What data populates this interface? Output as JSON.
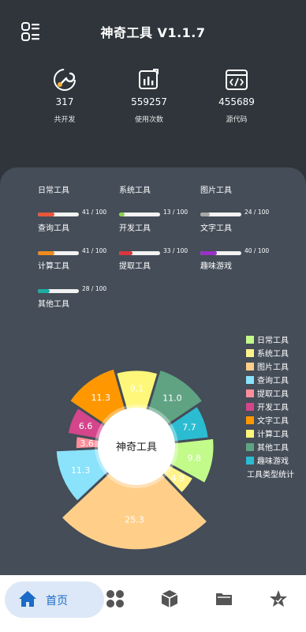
{
  "header": {
    "title": "神奇工具 V1.1.7"
  },
  "stats": [
    {
      "value": "317",
      "label": "共开发",
      "icon": "wrench-icon"
    },
    {
      "value": "559257",
      "label": "使用次数",
      "icon": "bar-chart-icon"
    },
    {
      "value": "455689",
      "label": "源代码",
      "icon": "code-window-icon"
    }
  ],
  "categories": {
    "headers": [
      "日常工具",
      "系统工具",
      "图片工具"
    ],
    "items": [
      {
        "label": "查询工具",
        "count": 41,
        "max": 100,
        "display": "41 / 100",
        "color": "#e8563a"
      },
      {
        "label": "开发工具",
        "count": 13,
        "max": 100,
        "display": "13 / 100",
        "color": "#8ed14b"
      },
      {
        "label": "文字工具",
        "count": 24,
        "max": 100,
        "display": "24 / 100",
        "color": "#a8a8a8"
      },
      {
        "label": "计算工具",
        "count": 41,
        "max": 100,
        "display": "41 / 100",
        "color": "#f08a1e"
      },
      {
        "label": "提取工具",
        "count": 33,
        "max": 100,
        "display": "33 / 100",
        "color": "#d9363e"
      },
      {
        "label": "趣味游戏",
        "count": 40,
        "max": 100,
        "display": "40 / 100",
        "color": "#9b30c8"
      },
      {
        "label": "其他工具",
        "count": 28,
        "max": 100,
        "display": "28 / 100",
        "color": "#1aaea0"
      }
    ]
  },
  "chart_data": {
    "type": "pie",
    "center_label": "神奇工具",
    "legend_title": "工具类型统计",
    "legend_position": "right",
    "slices": [
      {
        "name": "日常工具",
        "value": 9.8,
        "label": "9.8",
        "color": "#c2fb8a"
      },
      {
        "name": "系统工具",
        "value": 4.9,
        "label": "4.9",
        "color": "#fff38a"
      },
      {
        "name": "图片工具",
        "value": 25.3,
        "label": "25.3",
        "color": "#ffcf8a"
      },
      {
        "name": "查询工具",
        "value": 11.3,
        "label": "11.3",
        "color": "#8ae2fb"
      },
      {
        "name": "提取工具",
        "value": 3.6,
        "label": "3.6",
        "color": "#ff8e9a"
      },
      {
        "name": "开发工具",
        "value": 6.6,
        "label": "6.6",
        "color": "#d4458c"
      },
      {
        "name": "文字工具",
        "value": 11.3,
        "label": "11.3",
        "color": "#ff9800"
      },
      {
        "name": "计算工具",
        "value": 9.1,
        "label": "9.1",
        "color": "#fff77a"
      },
      {
        "name": "其他工具",
        "value": 11.0,
        "label": "11.0",
        "color": "#5fa383"
      },
      {
        "name": "趣味游戏",
        "value": 7.7,
        "label": "7.7",
        "color": "#2bbcd1"
      }
    ]
  },
  "nav": {
    "items": [
      {
        "label": "首页",
        "icon": "home-icon",
        "active": true
      },
      {
        "label": "",
        "icon": "apps-grid-icon"
      },
      {
        "label": "",
        "icon": "cube-icon"
      },
      {
        "label": "",
        "icon": "folder-icon"
      },
      {
        "label": "",
        "icon": "star-icon"
      }
    ],
    "active_color": "#1b6bc7",
    "inactive_color": "#555555"
  }
}
